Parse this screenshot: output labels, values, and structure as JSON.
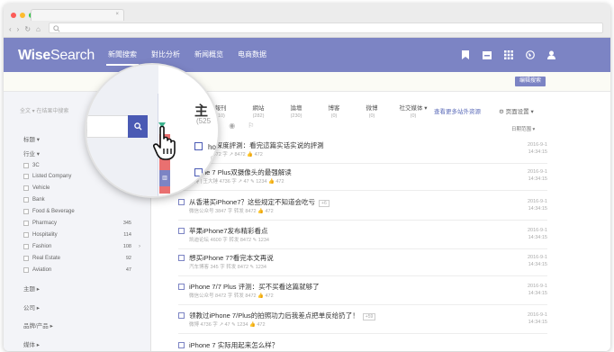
{
  "browser": {
    "tab_close": "×"
  },
  "app": {
    "logo_bold": "Wise",
    "logo_light": "Search",
    "nav": [
      "新聞搜索",
      "對比分析",
      "新闻概览",
      "电商数据"
    ],
    "active_nav": 0,
    "header_icons": [
      "bookmark-icon",
      "inbox-icon",
      "grid-icon",
      "globe-icon",
      "user-icon"
    ],
    "edit_button": "编辑搜索"
  },
  "sidebar": {
    "search_placeholder": "全文 ▾ 在结果中搜索",
    "sections": {
      "title": "标题 ▾",
      "industry": "行业 ▾",
      "topic": "主题 ▸",
      "company": "公司 ▸",
      "brand": "品牌/产品 ▸",
      "media": "媒体 ▸"
    },
    "industries": [
      {
        "label": "3C",
        "count": ""
      },
      {
        "label": "Listed Company",
        "count": ""
      },
      {
        "label": "Vehicle",
        "count": ""
      },
      {
        "label": "Bank",
        "count": ""
      },
      {
        "label": "Food & Beverage",
        "count": ""
      },
      {
        "label": "Pharmacy",
        "count": "345"
      },
      {
        "label": "Hospitality",
        "count": "114"
      },
      {
        "label": "Fashion",
        "count": "108"
      },
      {
        "label": "Real Estate",
        "count": "92"
      },
      {
        "label": "Aviation",
        "count": "47"
      }
    ]
  },
  "types": [
    {
      "label": "報刊",
      "count": "(10)"
    },
    {
      "label": "網站",
      "count": "(282)"
    },
    {
      "label": "論壇",
      "count": "(230)"
    },
    {
      "label": "博客",
      "count": "(0)"
    },
    {
      "label": "微博",
      "count": "(0)"
    },
    {
      "label": "社交媒体 ▾",
      "count": "(0)"
    }
  ],
  "more_link": "查看更多站外资源",
  "page_settings": "⚙ 页面设置 ▾",
  "date_filter": "日期范围 ▾",
  "results": [
    {
      "title": "iPhone 7深度評測：看完這篇实话实说的評測",
      "meta": "新浪科技  8472 字  ↗ 8472  👍 472",
      "date": "2016-9-1\n14:34:15"
    },
    {
      "title": "iPhone 7 Plus双摄像头的最强解读",
      "meta": "微博 | 王大锤  4736 字  ↗ 47  ✎ 1234  👍 472",
      "date": "2016-9-1\n14:34:15"
    },
    {
      "title": "从香港买iPhone7？这些规定不知道会吃亏",
      "meta": "微信公众号  3847 字  转发 8472  👍 472",
      "date": "2016-9-1\n14:34:15",
      "tag": "+6"
    },
    {
      "title": "苹果iPhone7发布精彩看点",
      "meta": "凯迪论坛  4600 字  转发 8472  ✎ 1234",
      "date": "2016-9-1\n14:34:15"
    },
    {
      "title": "想买iPhone 7?看完本文再说",
      "meta": "汽车博客  345 字  转发 8472  ✎ 1234",
      "date": "2016-9-1\n14:34:15"
    },
    {
      "title": "iPhone 7/7 Plus 评测：买不买看这篇就够了",
      "meta": "微信公众号  8472 字  转发 8472  👍 472",
      "date": "2016-9-1\n14:34:15"
    },
    {
      "title": "领教过iPhone 7/Plus的拍照功力后我差点把单反给扔了！",
      "meta": "微博  4736 字  ↗ 47  ✎ 1234  👍 472",
      "date": "2016-9-1\n14:34:15",
      "tag": "+59"
    },
    {
      "title": "iPhone 7 实际用起来怎么样？",
      "meta": "",
      "date": ""
    }
  ],
  "magnifier": {
    "title": "主",
    "subtitle": "(525",
    "count_value": "5920",
    "count_arrow": "›",
    "search_icon": "search-icon",
    "line1": "hone 7深度評測",
    "line1_meta": "8472 字  ↗ 8472",
    "line2": "ne 7 Plus双摄像头",
    "line2_meta": "4736 字  ↗ 47"
  },
  "colors": {
    "brand": "#7c84c4",
    "accent_green": "#3cb38e",
    "search_button": "#4a5ab4"
  }
}
